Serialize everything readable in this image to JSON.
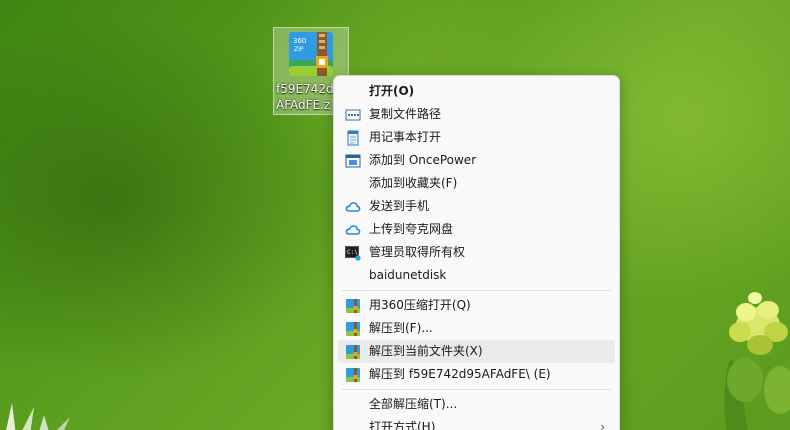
{
  "desktop": {
    "file": {
      "name_line1": "f59E742d",
      "name_line2": "AFAdFE.z",
      "icon_badge": "360 ZIP"
    }
  },
  "context_menu": {
    "groups": [
      [
        {
          "label": "打开(O)",
          "icon": "none",
          "bold": true
        },
        {
          "label": "复制文件路径",
          "icon": "copy-path-icon"
        },
        {
          "label": "用记事本打开",
          "icon": "notepad-icon"
        },
        {
          "label": "添加到 OncePower",
          "icon": "oncepower-icon"
        },
        {
          "label": "添加到收藏夹(F)",
          "icon": "none"
        },
        {
          "label": "发送到手机",
          "icon": "cloud-icon"
        },
        {
          "label": "上传到夸克网盘",
          "icon": "cloud-icon"
        },
        {
          "label": "管理员取得所有权",
          "icon": "terminal-icon"
        },
        {
          "label": "baidunetdisk",
          "icon": "none"
        }
      ],
      [
        {
          "label": "用360压缩打开(Q)",
          "icon": "360zip-icon"
        },
        {
          "label": "解压到(F)...",
          "icon": "360zip-icon"
        },
        {
          "label": "解压到当前文件夹(X)",
          "icon": "360zip-icon",
          "highlighted": true
        },
        {
          "label": "解压到 f59E742d95AFAdFE\\ (E)",
          "icon": "360zip-icon"
        }
      ],
      [
        {
          "label": "全部解压缩(T)...",
          "icon": "none"
        },
        {
          "label": "打开方式(H)",
          "icon": "none",
          "submenu": true
        }
      ]
    ]
  }
}
